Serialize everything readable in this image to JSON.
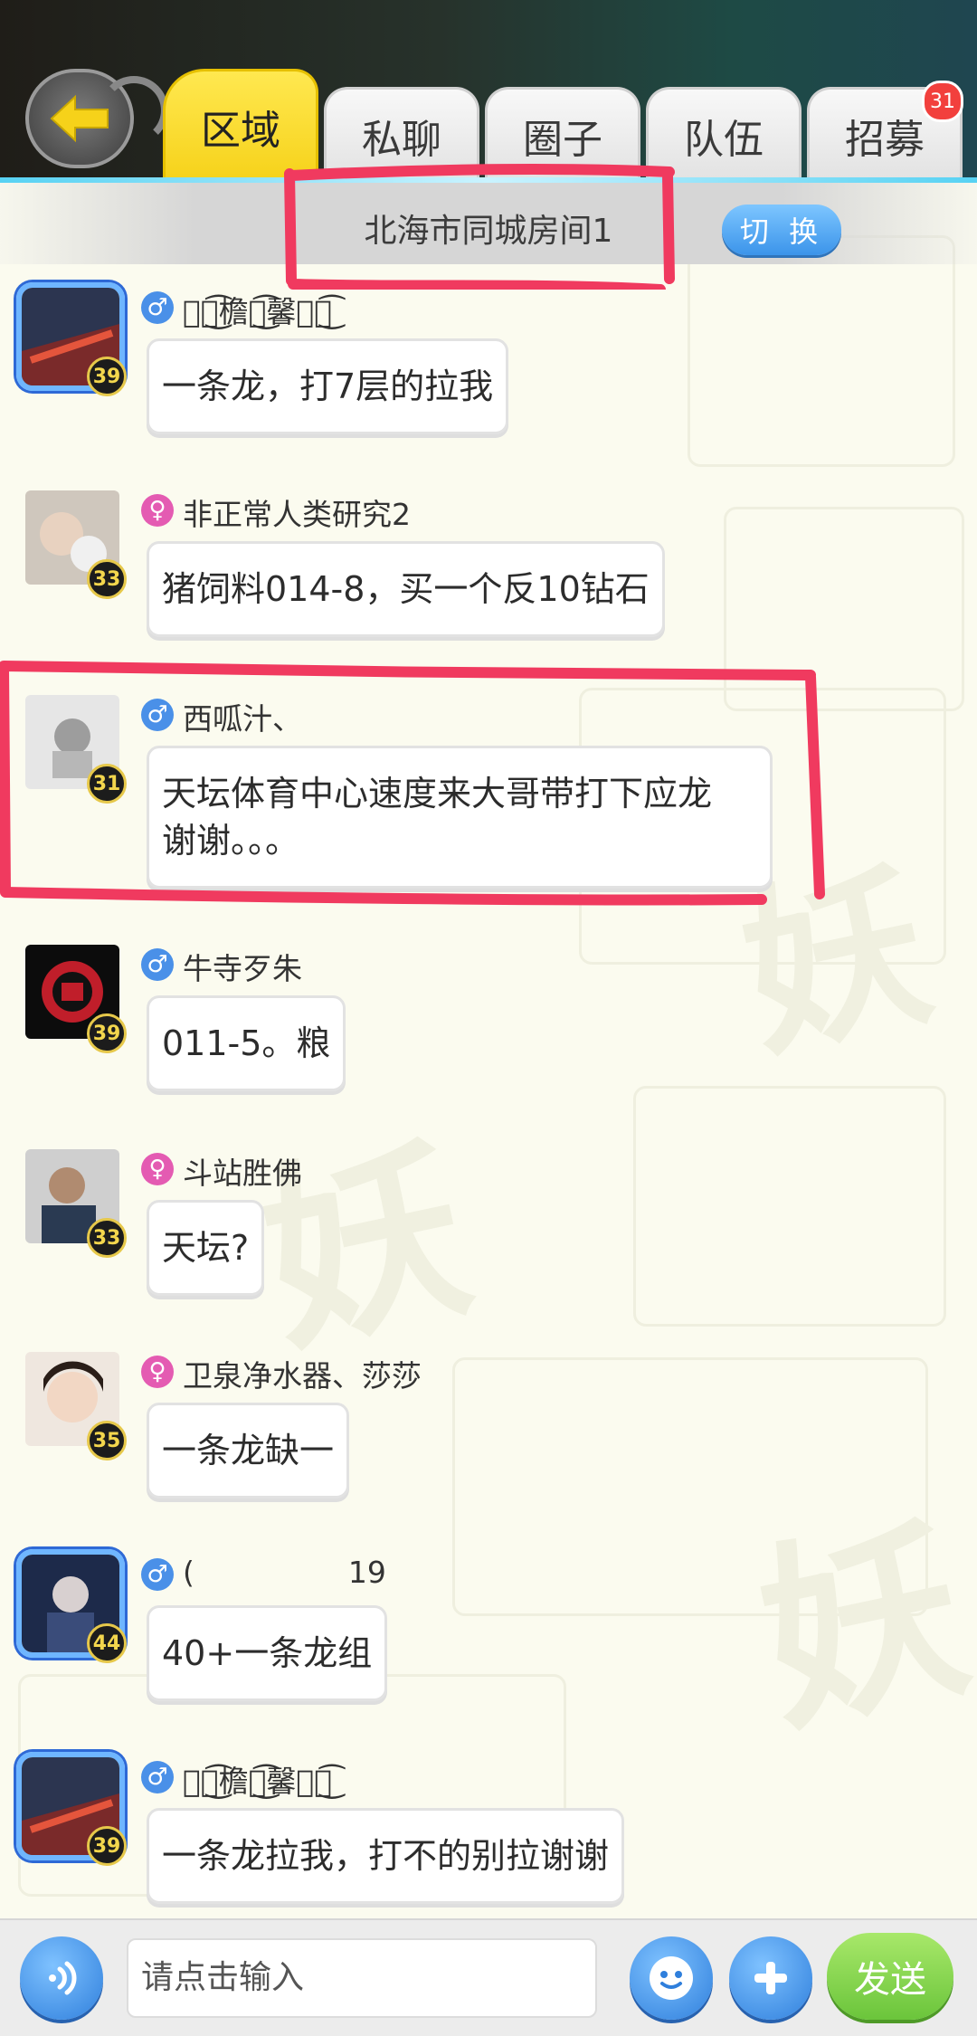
{
  "tabs": [
    {
      "label": "区域",
      "active": true
    },
    {
      "label": "私聊"
    },
    {
      "label": "圈子"
    },
    {
      "label": "队伍"
    },
    {
      "label": "招募",
      "badge": "31"
    }
  ],
  "room": {
    "name": "北海市同城房间1",
    "switch_label": "切 换"
  },
  "messages": [
    {
      "gender": "male",
      "level": "39",
      "username": "ৡৢ͜͡檐ং͜͡馨ৡৢ͜͡",
      "text": "一条龙，打7层的拉我"
    },
    {
      "gender": "female",
      "level": "33",
      "username": "非正常人类研究2",
      "text": "猪饲料014-8，买一个反10钻石"
    },
    {
      "gender": "male",
      "level": "31",
      "username": "西呱汁、",
      "text_line1": "天坛体育中心速度来大哥带打下应龙",
      "text_line2": "谢谢。。。"
    },
    {
      "gender": "male",
      "level": "39",
      "username": "牛寺歹朱",
      "text": "011-5。粮"
    },
    {
      "gender": "female",
      "level": "33",
      "username": "斗站胜佛",
      "text": "天坛?"
    },
    {
      "gender": "female",
      "level": "35",
      "username": "卫泉净水器、莎莎",
      "text": "一条龙缺一"
    },
    {
      "gender": "male",
      "level": "44",
      "username": "(",
      "username_suffix": "19",
      "text": "40+一条龙组"
    },
    {
      "gender": "male",
      "level": "39",
      "username": "ৡৢ͜͡檐ং͜͡馨ৡৢ͜͡",
      "text": "一条龙拉我，打不的别拉谢谢"
    }
  ],
  "gender_symbols": {
    "male": "♂",
    "female": "♀"
  },
  "input": {
    "placeholder": "请点击输入"
  },
  "send_label": "发送",
  "colors": {
    "annotation_red": "#f03a5f",
    "active_tab": "#f6d21a",
    "send_green": "#6bc53b"
  }
}
